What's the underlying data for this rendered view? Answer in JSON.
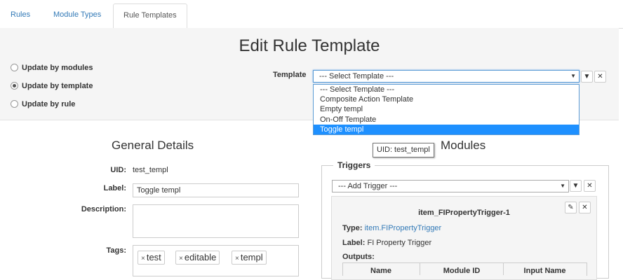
{
  "tabs": [
    {
      "label": "Rules"
    },
    {
      "label": "Module Types"
    },
    {
      "label": "Rule Templates"
    }
  ],
  "header": {
    "title": "Edit Rule Template",
    "radios": [
      {
        "label": "Update by modules",
        "checked": false
      },
      {
        "label": "Update by template",
        "checked": true
      },
      {
        "label": "Update by rule",
        "checked": false
      }
    ],
    "template_label": "Template",
    "template_select": "--- Select Template ---",
    "template_options": [
      "--- Select Template ---",
      "Composite Action Template",
      "Empty templ",
      "On-Off Template",
      "Toggle templ"
    ],
    "selected_option_index": 4
  },
  "tooltip": "UID: test_templ",
  "general": {
    "title": "General Details",
    "uid_label": "UID:",
    "uid_value": "test_templ",
    "label_label": "Label:",
    "label_value": "Toggle templ",
    "description_label": "Description:",
    "description_value": "",
    "tags_label": "Tags:",
    "tags": [
      "test",
      "editable",
      "templ"
    ]
  },
  "modules": {
    "title": "Modules",
    "triggers_legend": "Triggers",
    "add_trigger": "--- Add Trigger ---",
    "card": {
      "name": "item_FIPropertyTrigger-1",
      "type_label": "Type:",
      "type_value": "item.FIPropertyTrigger",
      "label_label": "Label:",
      "label_value": "FI Property Trigger",
      "outputs_label": "Outputs:",
      "columns": [
        "Name",
        "Module ID",
        "Input Name"
      ]
    }
  },
  "colors": {
    "link": "#337ab7",
    "selected_option": "#1e90ff",
    "header_bg": "#f5f5f5"
  }
}
